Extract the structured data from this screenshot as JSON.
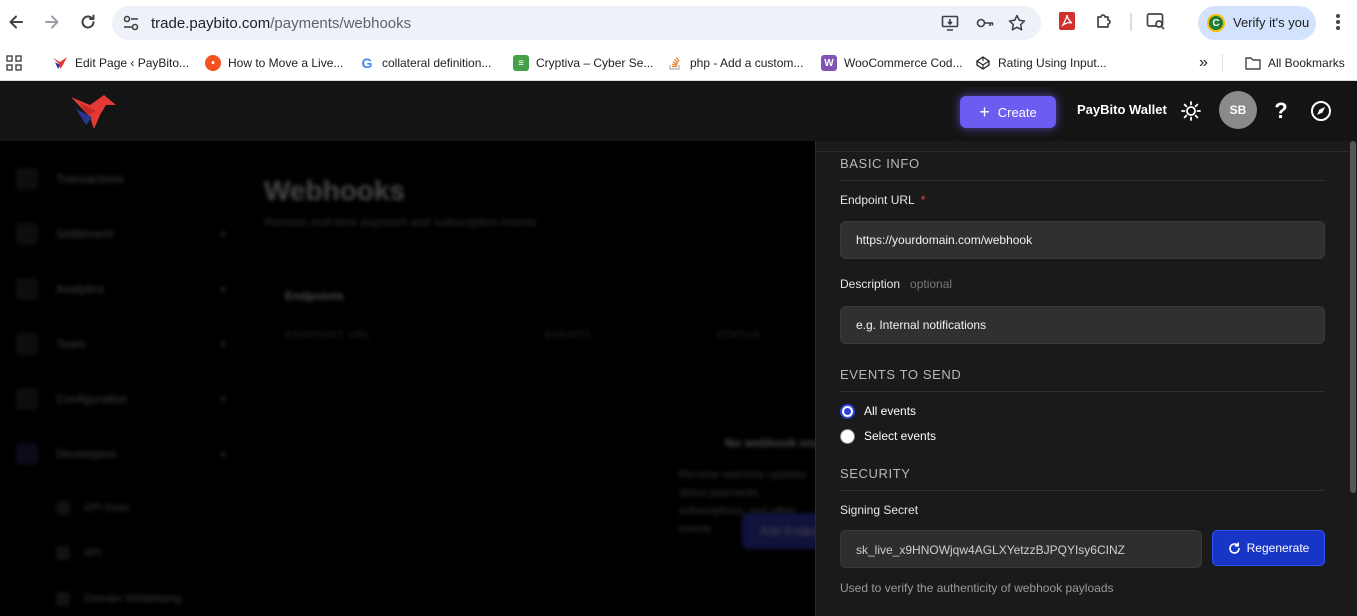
{
  "browser": {
    "url_host": "trade.paybito.com",
    "url_path": "/payments/webhooks",
    "profile_chip": {
      "initial": "C",
      "label": "Verify it's you"
    },
    "nav_icons": [
      "back-arrow-icon",
      "forward-arrow-icon",
      "reload-icon",
      "site-settings-icon"
    ],
    "omnibox_icons": [
      "install-app-icon",
      "password-key-icon",
      "bookmark-star-icon"
    ],
    "toolbar_icons": [
      "pdf-extension-icon",
      "extensions-puzzle-icon",
      "tab-search-icon",
      "menu-kebab-icon"
    ]
  },
  "bookmarks": {
    "apps_icon": "apps-grid-icon",
    "items": [
      {
        "label": "Edit Page ‹ PayBito...",
        "icon": "paybito-favicon",
        "color": "#e53935"
      },
      {
        "label": "How to Move a Live...",
        "icon": "orange-chat-favicon",
        "color": "#f4511e"
      },
      {
        "label": "collateral definition...",
        "icon": "google-favicon",
        "color": "#4285f4"
      },
      {
        "label": "Cryptiva – Cyber Se...",
        "icon": "cryptiva-favicon",
        "color": "#43a047"
      },
      {
        "label": "php - Add a custom...",
        "icon": "stackoverflow-favicon",
        "color": "#f48024"
      },
      {
        "label": "WooCommerce Cod...",
        "icon": "woocommerce-favicon",
        "color": "#7f54b3"
      },
      {
        "label": "Rating Using Input...",
        "icon": "codepen-favicon",
        "color": "#222222"
      }
    ],
    "overflow": "»",
    "all_bookmarks": "All Bookmarks"
  },
  "header": {
    "create_label": "Create",
    "wallet_label": "PayBito Wallet",
    "avatar_initials": "SB",
    "help_glyph": "?",
    "accent": "#6d5cf0"
  },
  "background_page": {
    "sidebar": [
      {
        "label": "Transactions",
        "has_chevron": false
      },
      {
        "label": "Settlement",
        "has_chevron": true
      },
      {
        "label": "Analytics",
        "has_chevron": true
      },
      {
        "label": "Team",
        "has_chevron": true
      },
      {
        "label": "Configuration",
        "has_chevron": true
      },
      {
        "label": "Developers",
        "has_chevron": true
      }
    ],
    "sub_items": [
      "API Keys",
      "API",
      "Domain Whitelisting"
    ],
    "title": "Webhooks",
    "subtitle": "Receive real-time payment and subscription events",
    "card_title": "Endpoints",
    "columns": [
      "ENDPOINT URL",
      "EVENTS",
      "STATUS"
    ],
    "empty_title": "No webhook endpoints",
    "empty_text": [
      "Receive real-time updates about payments,",
      "subscriptions, and other events"
    ],
    "add_button": "Add Endpoint"
  },
  "panel": {
    "basic_info_heading": "BASIC INFO",
    "endpoint_label": "Endpoint URL",
    "endpoint_required": "*",
    "endpoint_placeholder": "https://yourdomain.com/webhook",
    "description_label": "Description",
    "description_optional": "optional",
    "description_placeholder": "e.g. Internal notifications",
    "events_heading": "EVENTS TO SEND",
    "events_options": [
      {
        "label": "All events",
        "checked": true
      },
      {
        "label": "Select events",
        "checked": false
      }
    ],
    "security_heading": "SECURITY",
    "secret_label": "Signing Secret",
    "secret_value": "sk_live_x9HNOWjqw4AGLXYetzzBJPQYIsy6CINZ",
    "regenerate_label": "Regenerate",
    "secret_help": "Used to verify the authenticity of webhook payloads",
    "button_color": "#1836c6"
  }
}
